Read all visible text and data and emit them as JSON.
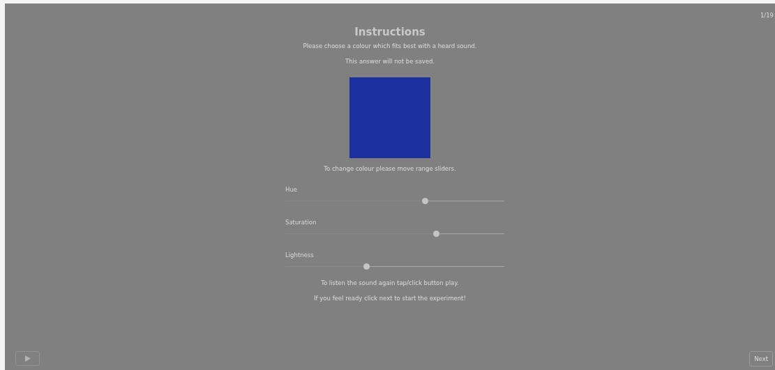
{
  "counter": "1/19",
  "title": "Instructions",
  "intro": [
    "Please choose a colour which fits best with a heard sound.",
    "This answer will not be saved."
  ],
  "swatch": {
    "color": "#1c2f9f"
  },
  "hint": "To change colour please move range sliders.",
  "sliders": [
    {
      "label": "Hue",
      "level": 0.637
    },
    {
      "label": "Saturation",
      "level": 0.688
    },
    {
      "label": "Lightness",
      "level": 0.369
    }
  ],
  "outro": [
    "To listen the sound again tap/click button play.",
    "If you feel ready click next to start the experiment!"
  ],
  "next_button": "Next"
}
